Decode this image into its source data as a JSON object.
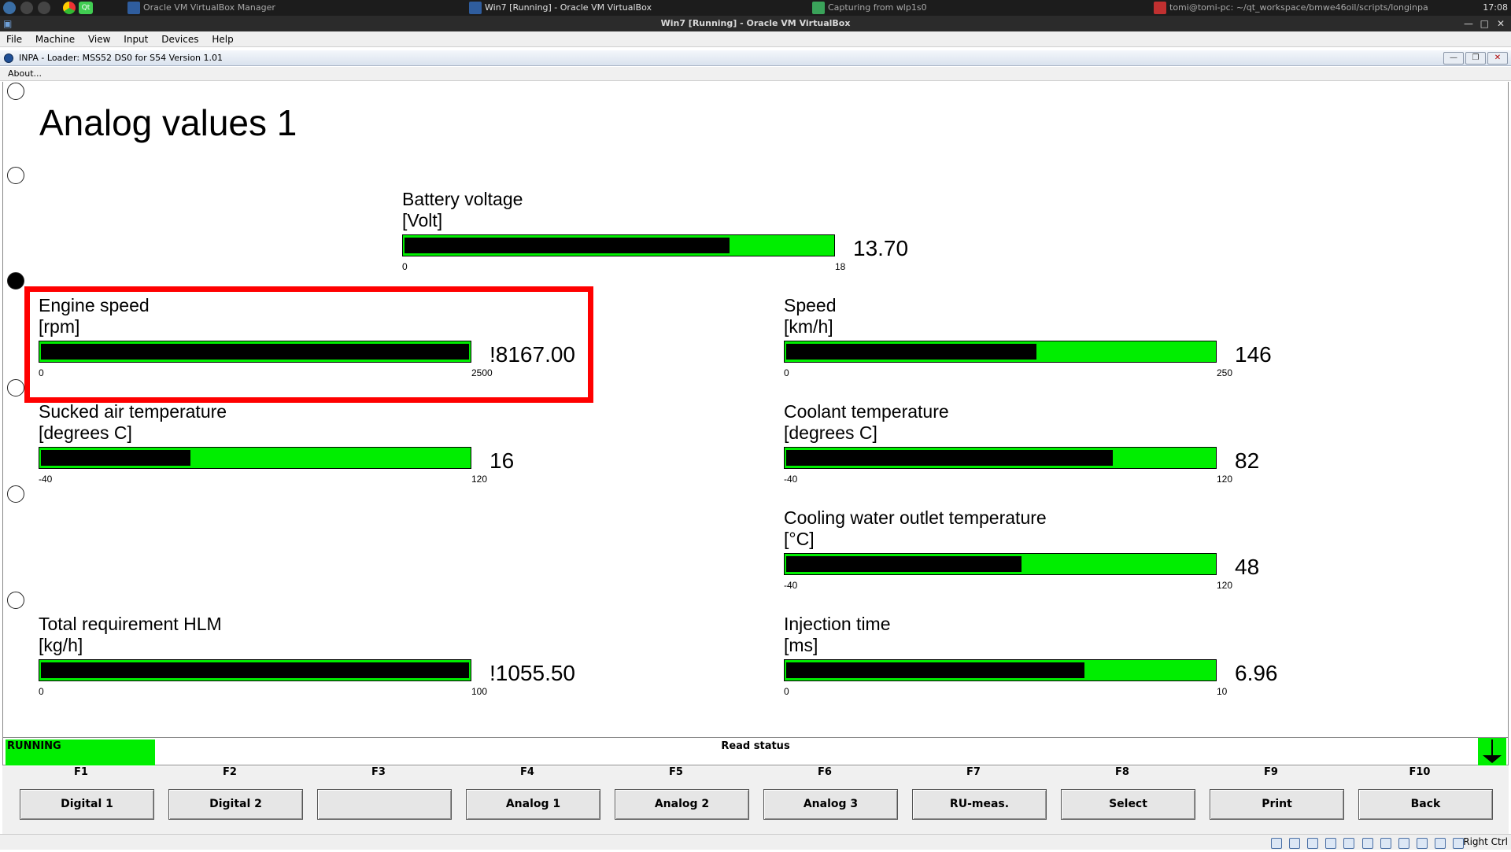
{
  "taskbar": {
    "items": [
      "Oracle VM VirtualBox Manager",
      "Win7 [Running] - Oracle VM VirtualBox",
      "Capturing from wlp1s0",
      "tomi@tomi-pc: ~/qt_workspace/bmwe46oil/scripts/longinpa"
    ],
    "clock": "17:08",
    "qt_badge": "Qt"
  },
  "vbox": {
    "title": "Win7 [Running] - Oracle VM VirtualBox",
    "menu": [
      "File",
      "Machine",
      "View",
      "Input",
      "Devices",
      "Help"
    ],
    "host_key": "Right Ctrl"
  },
  "inpa": {
    "title": "INPA - Loader:  MSS52 DS0 for S54 Version 1.01",
    "menu_about": "About...",
    "page_title": "Analog values 1",
    "gauges": {
      "battery": {
        "label": "Battery voltage",
        "unit": "[Volt]",
        "min": "0",
        "max": "18",
        "value": "13.70",
        "fill": 0.76
      },
      "engine": {
        "label": "Engine speed",
        "unit": "[rpm]",
        "min": "0",
        "max": "2500",
        "value": "!8167.00",
        "fill": 1.0
      },
      "speed": {
        "label": "Speed",
        "unit": "[km/h]",
        "min": "0",
        "max": "250",
        "value": "146",
        "fill": 0.584
      },
      "sucked": {
        "label": "Sucked air temperature",
        "unit": "[degrees C]",
        "min": "-40",
        "max": "120",
        "value": "16",
        "fill": 0.35
      },
      "coolant": {
        "label": "Coolant temperature",
        "unit": "[degrees C]",
        "min": "-40",
        "max": "120",
        "value": "82",
        "fill": 0.7625
      },
      "cooling": {
        "label": "Cooling water outlet temperature",
        "unit": "[°C]",
        "min": "-40",
        "max": "120",
        "value": "48",
        "fill": 0.55
      },
      "hlm": {
        "label": "Total requirement HLM",
        "unit": "[kg/h]",
        "min": "0",
        "max": "100",
        "value": "!1055.50",
        "fill": 1.0
      },
      "inject": {
        "label": "Injection time",
        "unit": "[ms]",
        "min": "0",
        "max": "10",
        "value": "6.96",
        "fill": 0.696
      }
    },
    "status": {
      "running": "RUNNING",
      "read_status": "Read status"
    },
    "fkeys": [
      {
        "key": "F1",
        "label": "Digital 1"
      },
      {
        "key": "F2",
        "label": "Digital 2"
      },
      {
        "key": "F3",
        "label": ""
      },
      {
        "key": "F4",
        "label": "Analog 1"
      },
      {
        "key": "F5",
        "label": "Analog 2"
      },
      {
        "key": "F6",
        "label": "Analog 3"
      },
      {
        "key": "F7",
        "label": "RU-meas."
      },
      {
        "key": "F8",
        "label": "Select"
      },
      {
        "key": "F9",
        "label": "Print"
      },
      {
        "key": "F10",
        "label": "Back"
      }
    ]
  },
  "colors": {
    "bar_green": "#00ee00",
    "bar_black": "#000000",
    "highlight": "#ff0000"
  }
}
